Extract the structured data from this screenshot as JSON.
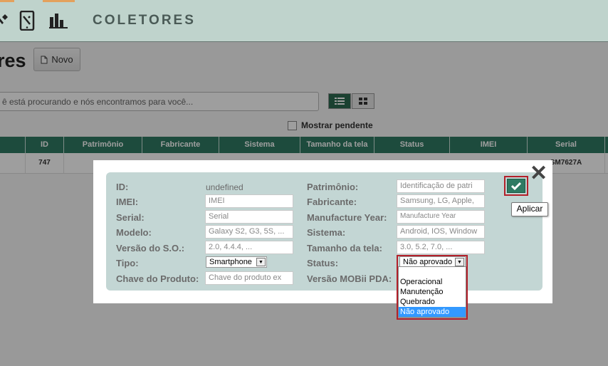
{
  "app": {
    "section_title": "COLETORES",
    "nav_icons": [
      "tools-icon",
      "tablet-icon",
      "bar-chart-icon"
    ],
    "accent_color": "#e3a15d"
  },
  "page": {
    "title": "res",
    "new_button_label": "Novo",
    "search_placeholder": "ê está procurando e nós encontramos para você...",
    "show_pending_label": "Mostrar pendente",
    "list_view_icon": "list-icon",
    "grid_view_icon": "grid-icon"
  },
  "table": {
    "headers": [
      "ID",
      "Patrimônio",
      "Fabricante",
      "Sistema",
      "Tamanho da tela",
      "Status",
      "IMEI",
      "Serial"
    ],
    "rows": [
      {
        "id": "747",
        "serial": "SM7627A"
      }
    ],
    "header_color": "#2f7a63"
  },
  "modal": {
    "fields": {
      "id_label": "ID:",
      "id_value": "undefined",
      "imei_label": "IMEI:",
      "imei_placeholder": "IMEI",
      "serial_label": "Serial:",
      "serial_placeholder": "Serial",
      "modelo_label": "Modelo:",
      "modelo_placeholder": "Galaxy S2, G3, 5S, ...",
      "versao_so_label": "Versão do S.O.:",
      "versao_so_placeholder": "2.0, 4.4.4, ...",
      "tipo_label": "Tipo:",
      "tipo_value": "Smartphone",
      "chave_label": "Chave do Produto:",
      "chave_placeholder": "Chave do produto ex",
      "patrimonio_label": "Patrimônio:",
      "patrimonio_placeholder": "Identificação de patri",
      "fabricante_label": "Fabricante:",
      "fabricante_placeholder": "Samsung, LG, Apple,",
      "manufacture_label": "Manufacture Year:",
      "manufacture_placeholder": "Manufacture Year",
      "sistema_label": "Sistema:",
      "sistema_placeholder": "Android, IOS, Window",
      "tamanho_label": "Tamanho da tela:",
      "tamanho_placeholder": "3.0, 5.2, 7.0, ...",
      "status_label": "Status:",
      "status_value": "Não aprovado",
      "mobii_label": "Versão MOBii PDA:"
    },
    "status_options": [
      "",
      "Operacional",
      "Manutenção",
      "Quebrado",
      "Não aprovado"
    ],
    "status_selected_index": 4,
    "apply_tooltip": "Aplicar",
    "apply_icon": "check-icon",
    "close_icon": "close-icon",
    "highlight_color": "#b3202a"
  }
}
